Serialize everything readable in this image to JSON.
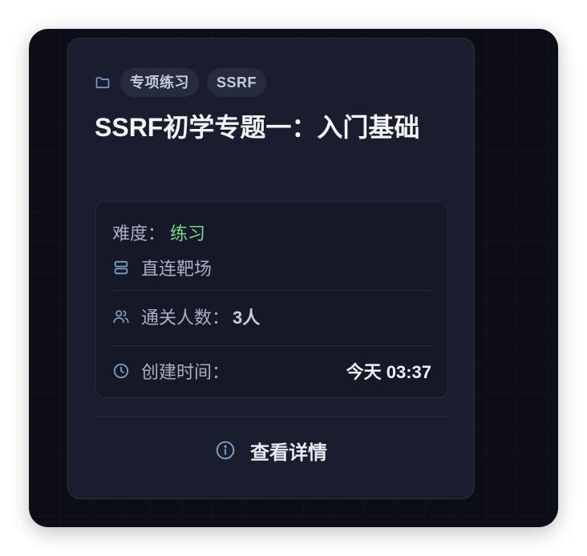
{
  "card": {
    "tags": [
      "专项练习",
      "SSRF"
    ],
    "title": "SSRF初学专题一：入门基础",
    "difficulty_label": "难度：",
    "difficulty_value": "练习",
    "range_type": "直连靶场",
    "passers_label": "通关人数：",
    "passers_value": "3人",
    "created_label": "创建时间：",
    "created_value": "今天 03:37",
    "detail_button_label": "查看详情"
  },
  "icons": {
    "tags": "folder-icon",
    "range": "server-icon",
    "passers": "users-icon",
    "created": "clock-icon",
    "detail": "info-icon"
  },
  "colors": {
    "frame_background": "#0b0d17",
    "card_background": "#1a1d2e",
    "difficulty_value": "#7ed88a",
    "icon_accent": "#7f9ec4"
  }
}
